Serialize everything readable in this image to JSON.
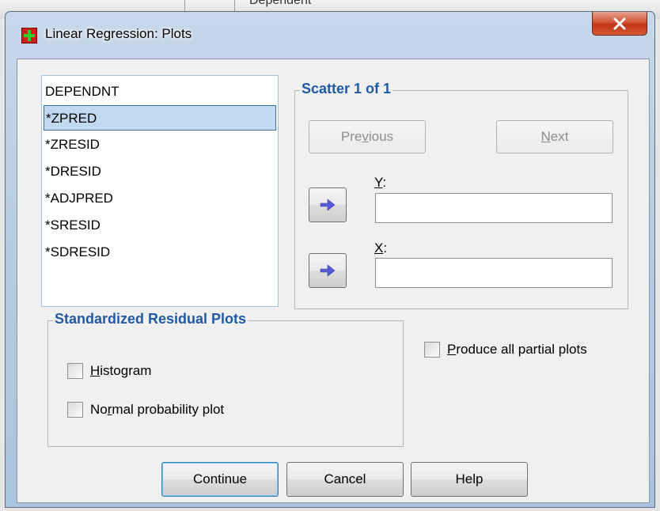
{
  "background": {
    "text": "Dependent"
  },
  "window": {
    "title": "Linear Regression: Plots",
    "close_icon": "close-icon"
  },
  "variables": [
    "DEPENDNT",
    "*ZPRED",
    "*ZRESID",
    "*DRESID",
    "*ADJPRED",
    "*SRESID",
    "*SDRESID"
  ],
  "selected_variable": "*ZPRED",
  "scatter": {
    "title": "Scatter 1 of 1",
    "previous": {
      "pre": "Pre",
      "key": "v",
      "post": "ious"
    },
    "next": {
      "pre": "",
      "key": "N",
      "post": "ext"
    },
    "y": {
      "key": "Y",
      "post": ":",
      "value": ""
    },
    "x": {
      "key": "X",
      "post": ":",
      "value": ""
    },
    "arrow_icon": "arrow-right-icon"
  },
  "standardized": {
    "title": "Standardized Residual Plots",
    "histogram": {
      "pre": "",
      "key": "H",
      "post": "istogram",
      "checked": false
    },
    "normal": {
      "pre": "No",
      "key": "r",
      "post": "mal probability plot",
      "checked": false
    }
  },
  "partial": {
    "pre": "",
    "key": "P",
    "post": "roduce all partial plots",
    "checked": false
  },
  "buttons": {
    "continue": "Continue",
    "cancel": "Cancel",
    "help": "Help"
  },
  "colors": {
    "group_title": "#1f5ba5",
    "selection": "#c1daf2",
    "arrow": "#5a5ad6",
    "close": "#c23515"
  }
}
